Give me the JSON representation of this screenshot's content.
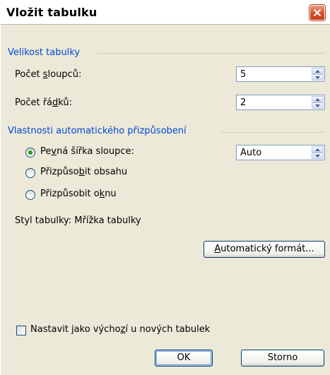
{
  "dialog": {
    "title": "Vložit tabulku"
  },
  "size_group": {
    "title": "Velikost tabulky",
    "columns_label_pre": "Počet ",
    "columns_label_ul": "s",
    "columns_label_post": "loupců:",
    "columns_value": "5",
    "rows_label_pre": "Počet řá",
    "rows_label_ul": "d",
    "rows_label_post": "ků:",
    "rows_value": "2"
  },
  "autofit_group": {
    "title": "Vlastnosti automatického přizpůsobení",
    "fixed_pre": "Pe",
    "fixed_ul": "v",
    "fixed_post": "ná šířka sloupce:",
    "fixed_value": "Auto",
    "content_pre": "Přizpůso",
    "content_ul": "b",
    "content_post": "it obsahu",
    "window_pre": "Přizpůsobit o",
    "window_ul": "k",
    "window_post": "nu",
    "selected": "fixed"
  },
  "table_style": {
    "label": "Styl tabulky: Mřížka tabulky"
  },
  "buttons": {
    "autoformat_ul": "A",
    "autoformat_rest": "utomatický formát...",
    "ok": "OK",
    "cancel": "Storno"
  },
  "default_checkbox": {
    "pre": "Nastavit jako výcho",
    "ul": "z",
    "post": "í u nových tabulek",
    "checked": false
  },
  "icons": {
    "close": "close-icon",
    "spin_up": "spin-up-icon",
    "spin_down": "spin-down-icon"
  },
  "colors": {
    "group_title": "#0046d5",
    "radio_dot": "#21a121",
    "close_button": "#d6512a"
  }
}
